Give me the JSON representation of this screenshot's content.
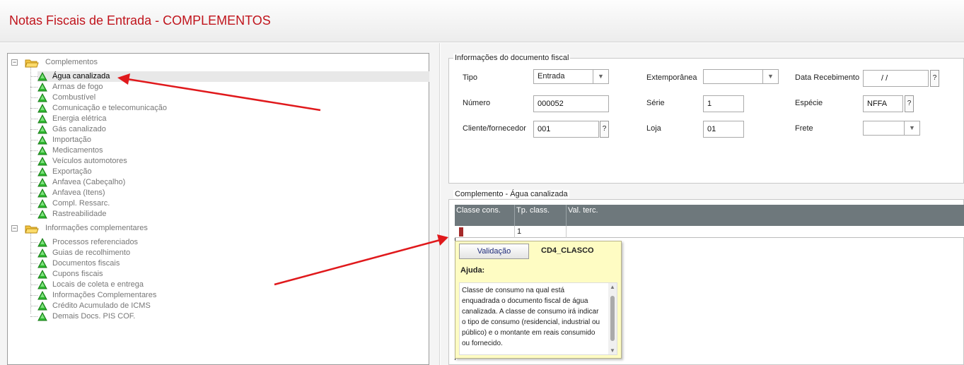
{
  "window": {
    "title": "Notas Fiscais de Entrada - COMPLEMENTOS"
  },
  "tree": {
    "root1": {
      "label": "Complementos",
      "items": [
        "Água canalizada",
        "Armas de fogo",
        "Combustível",
        "Comunicação e telecomunicação",
        "Energia elétrica",
        "Gás canalizado",
        "Importação",
        "Medicamentos",
        "Veículos automotores",
        "Exportação",
        "Anfavea (Cabeçalho)",
        "Anfavea (Itens)",
        "Compl. Ressarc.",
        "Rastreabilidade"
      ]
    },
    "root2": {
      "label": "Informações complementares",
      "items": [
        "Processos referenciados",
        "Guias de recolhimento",
        "Documentos fiscais",
        "Cupons fiscais",
        "Locais de coleta e entrega",
        "Informações Complementares",
        "Crédito Acumulado de ICMS",
        "Demais Docs. PIS COF."
      ]
    },
    "selected_item": "Água canalizada"
  },
  "doc": {
    "legend": "Informações do documento fiscal",
    "tipo_label": "Tipo",
    "tipo_value": "Entrada",
    "extemporanea_label": "Extemporânea",
    "extemporanea_value": "",
    "data_label": "Data Recebimento",
    "data_value": "/ /",
    "numero_label": "Número",
    "numero_value": "000052",
    "serie_label": "Série",
    "serie_value": "1",
    "especie_label": "Espécie",
    "especie_value": "NFFA",
    "cliente_label": "Cliente/fornecedor",
    "cliente_value": "001",
    "loja_label": "Loja",
    "loja_value": "01",
    "frete_label": "Frete",
    "frete_value": "",
    "lookup_symbol": "?"
  },
  "complement": {
    "legend": "Complemento - Água canalizada",
    "columns": [
      "Classe cons.",
      "Tp. class.",
      "Val. terc."
    ],
    "row": {
      "classe": "",
      "tp_class": "1",
      "val_terc": ""
    }
  },
  "help": {
    "button_label": "Validação",
    "field_name": "CD4_CLASCO",
    "title": "Ajuda:",
    "text": "Classe de consumo na qual está enquadrada o documento fiscal de água canalizada. A classe de consumo irá indicar o tipo de consumo (residencial, industrial ou público) e o montante em reais consumido ou fornecido."
  },
  "colors": {
    "title_red": "#c0141c",
    "grid_header": "#6e787c",
    "help_bg": "#fefcc3",
    "arrow_red": "#e0191c",
    "tree_icon_green": "#2eb82e"
  },
  "icons": {
    "folder": "folder-icon",
    "tree_item": "green-triangle-icon",
    "expander": "collapse-toggle-icon",
    "dropdown": "chevron-down-icon"
  }
}
